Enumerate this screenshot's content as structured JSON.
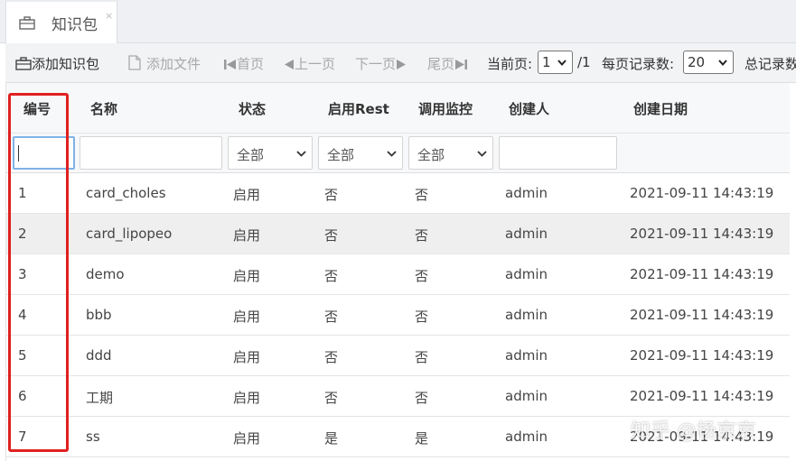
{
  "tab": {
    "label": "知识包",
    "close": "×",
    "icon": "briefcase-icon"
  },
  "toolbar": {
    "add_package": "添加知识包",
    "add_file": "添加文件",
    "first_page": "首页",
    "prev_page": "上一页",
    "next_page": "下一页",
    "last_page": "尾页",
    "current_page_label": "当前页:",
    "current_page_value": "1",
    "total_pages": "/1",
    "page_size_label": "每页记录数:",
    "page_size_value": "20",
    "total_records_label": "总记录数"
  },
  "table": {
    "columns": [
      "编号",
      "名称",
      "状态",
      "启用Rest",
      "调用监控",
      "创建人",
      "创建日期"
    ],
    "filters": {
      "status": "全部",
      "rest": "全部",
      "monitor": "全部"
    },
    "rows": [
      [
        "1",
        "card_choles",
        "启用",
        "否",
        "否",
        "admin",
        "2021-09-11 14:43:19"
      ],
      [
        "2",
        "card_lipopeo",
        "启用",
        "否",
        "否",
        "admin",
        "2021-09-11 14:43:19"
      ],
      [
        "3",
        "demo",
        "启用",
        "否",
        "否",
        "admin",
        "2021-09-11 14:43:19"
      ],
      [
        "4",
        "bbb",
        "启用",
        "否",
        "否",
        "admin",
        "2021-09-11 14:43:19"
      ],
      [
        "5",
        "ddd",
        "启用",
        "否",
        "否",
        "admin",
        "2021-09-11 14:43:19"
      ],
      [
        "6",
        "工期",
        "启用",
        "否",
        "否",
        "admin",
        "2021-09-11 14:43:19"
      ],
      [
        "7",
        "ss",
        "启用",
        "是",
        "是",
        "admin",
        "2021-09-11 14:43:19"
      ]
    ]
  },
  "watermark": "知乎 @杨京京",
  "colors": {
    "highlight": "#e02020",
    "focus": "#7fb3e6"
  }
}
